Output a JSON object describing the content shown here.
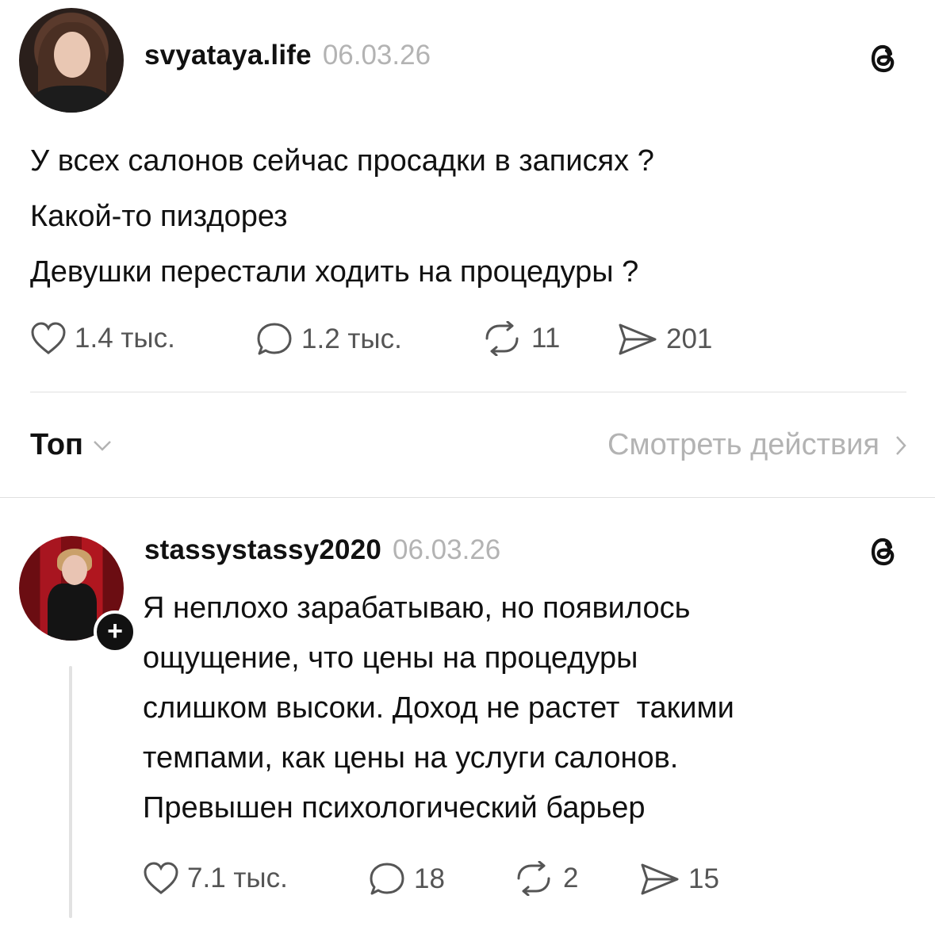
{
  "post": {
    "username": "svyataya.life",
    "date": "06.03.26",
    "lines": [
      "У всех салонов сейчас просадки в записях ?",
      "Какой-то пиздорез",
      "Девушки перестали ходить на процедуры ?"
    ],
    "likes": "1.4 тыс.",
    "comments": "1.2 тыс.",
    "reposts": "11",
    "shares": "201"
  },
  "sort": {
    "label": "Топ",
    "see_actions": "Смотреть действия"
  },
  "reply": {
    "username": "stassystassy2020",
    "date": "06.03.26",
    "lines": [
      "Я неплохо зарабатываю, но появилось",
      "ощущение, что цены на процедуры",
      "слишком высоки. Доход не растет  такими",
      "темпами, как цены на услуги салонов.",
      "Превышен психологический барьер"
    ],
    "likes": "7.1 тыс.",
    "comments": "18",
    "reposts": "2",
    "shares": "15",
    "follow_badge": "+"
  },
  "icons": {
    "threads": "threads-logo-icon",
    "like": "heart-icon",
    "comment": "comment-bubble-icon",
    "repost": "repost-icon",
    "share": "share-plane-icon"
  }
}
